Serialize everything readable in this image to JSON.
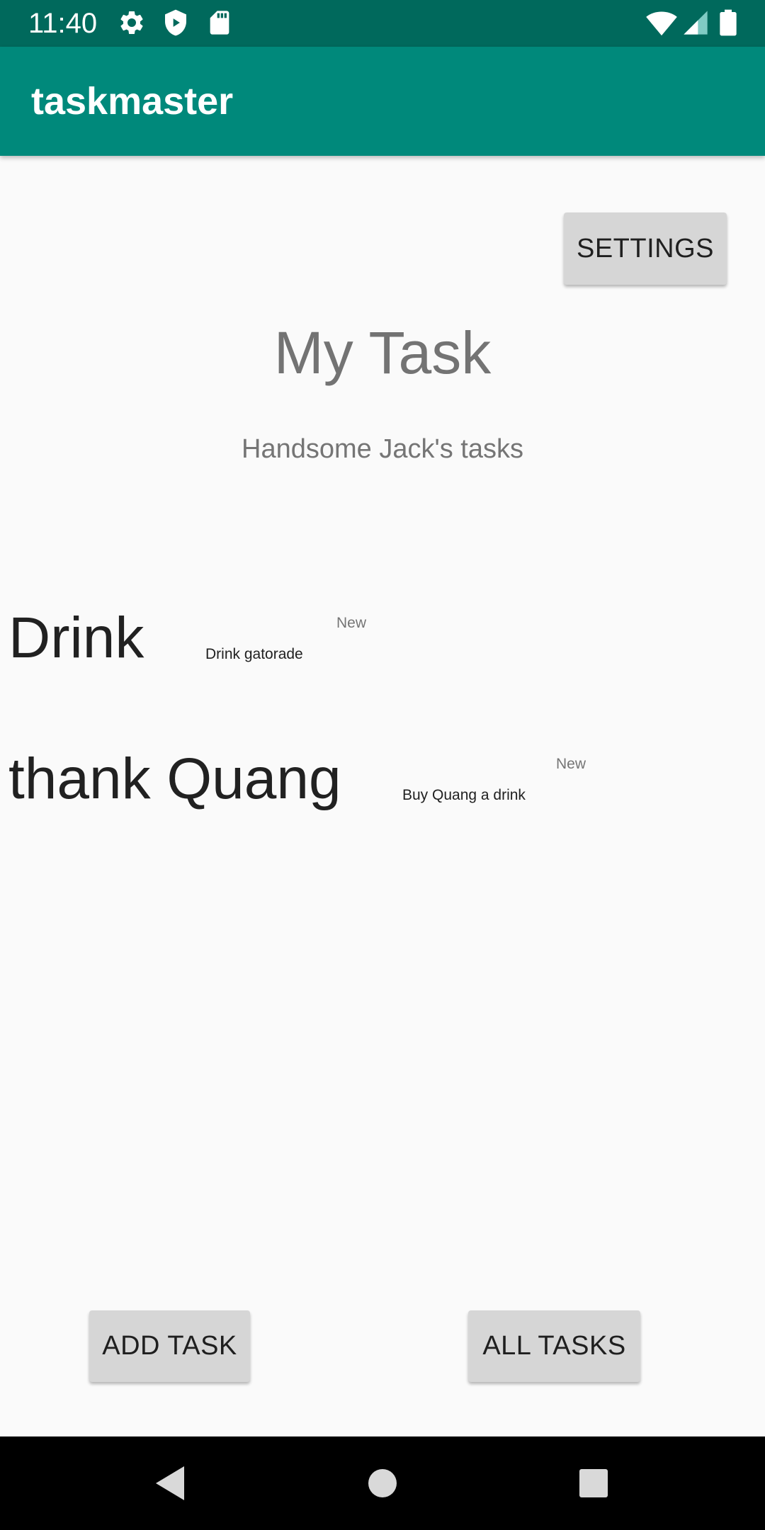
{
  "status_bar": {
    "time": "11:40",
    "left_icons": [
      "gear-icon",
      "shield-icon",
      "sd-card-icon"
    ],
    "right_icons": [
      "wifi-icon",
      "signal-icon",
      "battery-icon"
    ]
  },
  "app_bar": {
    "title": "taskmaster",
    "color": "#00897b"
  },
  "toolbar": {
    "settings_label": "SETTINGS"
  },
  "main": {
    "title": "My Task",
    "subtitle": "Handsome Jack's tasks",
    "tasks": [
      {
        "title": "Drink",
        "body": "Drink gatorade",
        "state": "New"
      },
      {
        "title": "thank Quang",
        "body": "Buy Quang a drink",
        "state": "New"
      }
    ]
  },
  "footer": {
    "add_task_label": "ADD TASK",
    "all_tasks_label": "ALL TASKS"
  },
  "nav_bar": {
    "icons": [
      "back-icon",
      "home-icon",
      "recents-icon"
    ]
  }
}
